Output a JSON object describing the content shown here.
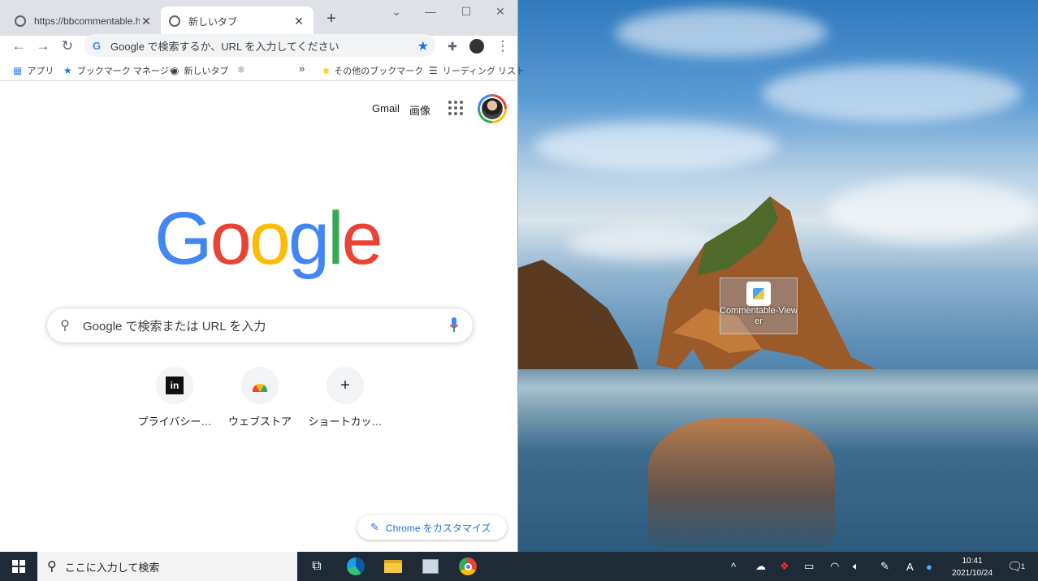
{
  "browser": {
    "tabs": [
      {
        "title": "https://bbcommentable.h",
        "active": false
      },
      {
        "title": "新しいタブ",
        "active": true
      }
    ],
    "omnibox_placeholder": "Google で検索するか、URL を入力してください",
    "bookmarks": {
      "apps": "アプリ",
      "bookmark_manager": "ブックマーク マネージャ",
      "new_tab": "新しいタブ",
      "more": "»",
      "other_bookmarks": "その他のブックマーク",
      "reading_list": "リーディング リスト"
    }
  },
  "ntp": {
    "gmail": "Gmail",
    "images": "画像",
    "logo": [
      "G",
      "o",
      "o",
      "g",
      "l",
      "e"
    ],
    "search_placeholder": "Google で検索または URL を入力",
    "shortcuts": [
      {
        "label": "プライバシー…",
        "icon": "ie-icon"
      },
      {
        "label": "ウェブストア",
        "icon": "webstore-icon"
      },
      {
        "label": "ショートカッ…",
        "icon": "plus-icon"
      }
    ],
    "customize": "Chrome をカスタマイズ"
  },
  "desktop": {
    "icon_label": "Commentable-Viewer"
  },
  "taskbar": {
    "search_placeholder": "ここに入力して検索",
    "time": "10:41",
    "date": "2021/10/24",
    "ime": "A",
    "notification_count": "1"
  },
  "colors": {
    "google_blue": "#4285f4",
    "google_red": "#ea4335",
    "google_yellow": "#fbbc05",
    "google_green": "#34a853",
    "accent": "#1a73e8"
  }
}
